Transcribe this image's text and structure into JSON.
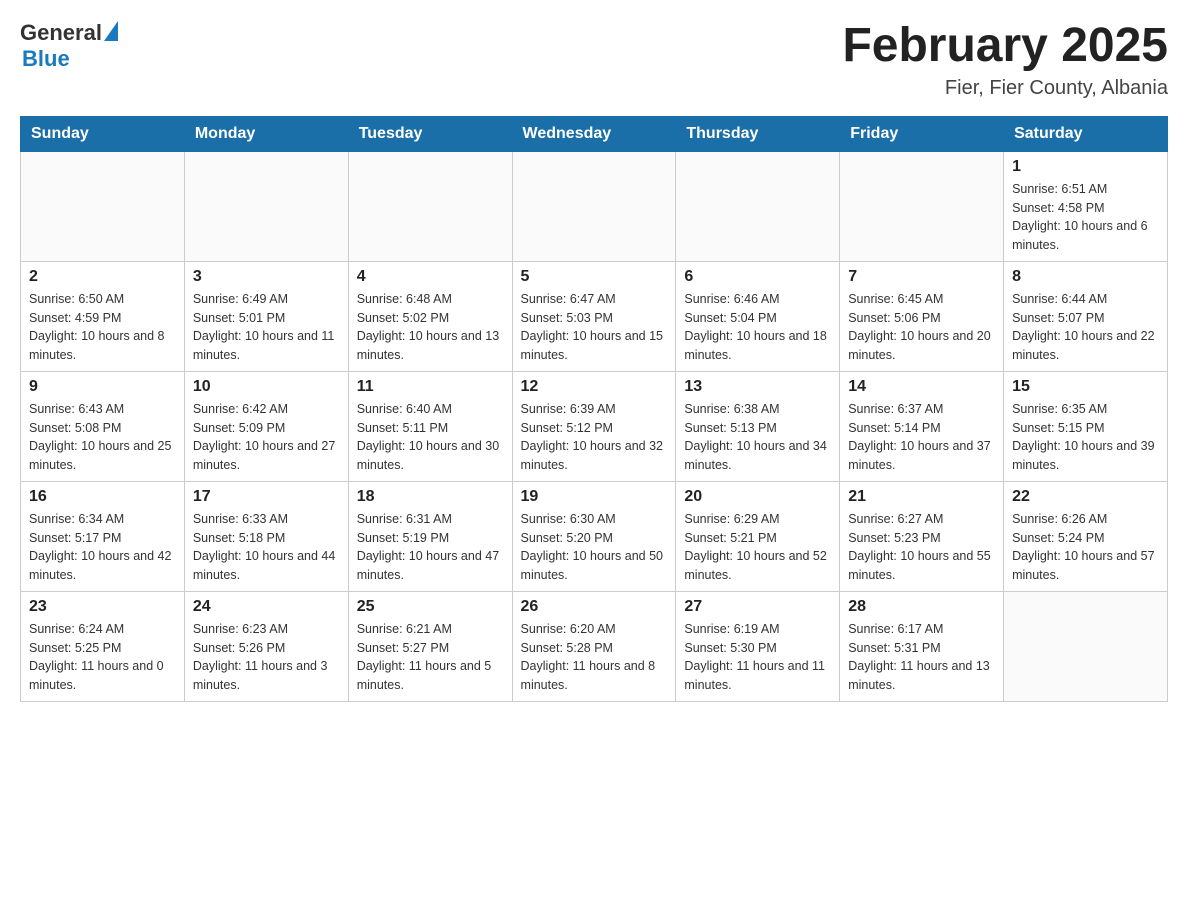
{
  "header": {
    "logo_general": "General",
    "logo_blue": "Blue",
    "month_title": "February 2025",
    "location": "Fier, Fier County, Albania"
  },
  "days_of_week": [
    "Sunday",
    "Monday",
    "Tuesday",
    "Wednesday",
    "Thursday",
    "Friday",
    "Saturday"
  ],
  "weeks": [
    {
      "days": [
        {
          "num": "",
          "info": ""
        },
        {
          "num": "",
          "info": ""
        },
        {
          "num": "",
          "info": ""
        },
        {
          "num": "",
          "info": ""
        },
        {
          "num": "",
          "info": ""
        },
        {
          "num": "",
          "info": ""
        },
        {
          "num": "1",
          "info": "Sunrise: 6:51 AM\nSunset: 4:58 PM\nDaylight: 10 hours and 6 minutes."
        }
      ]
    },
    {
      "days": [
        {
          "num": "2",
          "info": "Sunrise: 6:50 AM\nSunset: 4:59 PM\nDaylight: 10 hours and 8 minutes."
        },
        {
          "num": "3",
          "info": "Sunrise: 6:49 AM\nSunset: 5:01 PM\nDaylight: 10 hours and 11 minutes."
        },
        {
          "num": "4",
          "info": "Sunrise: 6:48 AM\nSunset: 5:02 PM\nDaylight: 10 hours and 13 minutes."
        },
        {
          "num": "5",
          "info": "Sunrise: 6:47 AM\nSunset: 5:03 PM\nDaylight: 10 hours and 15 minutes."
        },
        {
          "num": "6",
          "info": "Sunrise: 6:46 AM\nSunset: 5:04 PM\nDaylight: 10 hours and 18 minutes."
        },
        {
          "num": "7",
          "info": "Sunrise: 6:45 AM\nSunset: 5:06 PM\nDaylight: 10 hours and 20 minutes."
        },
        {
          "num": "8",
          "info": "Sunrise: 6:44 AM\nSunset: 5:07 PM\nDaylight: 10 hours and 22 minutes."
        }
      ]
    },
    {
      "days": [
        {
          "num": "9",
          "info": "Sunrise: 6:43 AM\nSunset: 5:08 PM\nDaylight: 10 hours and 25 minutes."
        },
        {
          "num": "10",
          "info": "Sunrise: 6:42 AM\nSunset: 5:09 PM\nDaylight: 10 hours and 27 minutes."
        },
        {
          "num": "11",
          "info": "Sunrise: 6:40 AM\nSunset: 5:11 PM\nDaylight: 10 hours and 30 minutes."
        },
        {
          "num": "12",
          "info": "Sunrise: 6:39 AM\nSunset: 5:12 PM\nDaylight: 10 hours and 32 minutes."
        },
        {
          "num": "13",
          "info": "Sunrise: 6:38 AM\nSunset: 5:13 PM\nDaylight: 10 hours and 34 minutes."
        },
        {
          "num": "14",
          "info": "Sunrise: 6:37 AM\nSunset: 5:14 PM\nDaylight: 10 hours and 37 minutes."
        },
        {
          "num": "15",
          "info": "Sunrise: 6:35 AM\nSunset: 5:15 PM\nDaylight: 10 hours and 39 minutes."
        }
      ]
    },
    {
      "days": [
        {
          "num": "16",
          "info": "Sunrise: 6:34 AM\nSunset: 5:17 PM\nDaylight: 10 hours and 42 minutes."
        },
        {
          "num": "17",
          "info": "Sunrise: 6:33 AM\nSunset: 5:18 PM\nDaylight: 10 hours and 44 minutes."
        },
        {
          "num": "18",
          "info": "Sunrise: 6:31 AM\nSunset: 5:19 PM\nDaylight: 10 hours and 47 minutes."
        },
        {
          "num": "19",
          "info": "Sunrise: 6:30 AM\nSunset: 5:20 PM\nDaylight: 10 hours and 50 minutes."
        },
        {
          "num": "20",
          "info": "Sunrise: 6:29 AM\nSunset: 5:21 PM\nDaylight: 10 hours and 52 minutes."
        },
        {
          "num": "21",
          "info": "Sunrise: 6:27 AM\nSunset: 5:23 PM\nDaylight: 10 hours and 55 minutes."
        },
        {
          "num": "22",
          "info": "Sunrise: 6:26 AM\nSunset: 5:24 PM\nDaylight: 10 hours and 57 minutes."
        }
      ]
    },
    {
      "days": [
        {
          "num": "23",
          "info": "Sunrise: 6:24 AM\nSunset: 5:25 PM\nDaylight: 11 hours and 0 minutes."
        },
        {
          "num": "24",
          "info": "Sunrise: 6:23 AM\nSunset: 5:26 PM\nDaylight: 11 hours and 3 minutes."
        },
        {
          "num": "25",
          "info": "Sunrise: 6:21 AM\nSunset: 5:27 PM\nDaylight: 11 hours and 5 minutes."
        },
        {
          "num": "26",
          "info": "Sunrise: 6:20 AM\nSunset: 5:28 PM\nDaylight: 11 hours and 8 minutes."
        },
        {
          "num": "27",
          "info": "Sunrise: 6:19 AM\nSunset: 5:30 PM\nDaylight: 11 hours and 11 minutes."
        },
        {
          "num": "28",
          "info": "Sunrise: 6:17 AM\nSunset: 5:31 PM\nDaylight: 11 hours and 13 minutes."
        },
        {
          "num": "",
          "info": ""
        }
      ]
    }
  ]
}
